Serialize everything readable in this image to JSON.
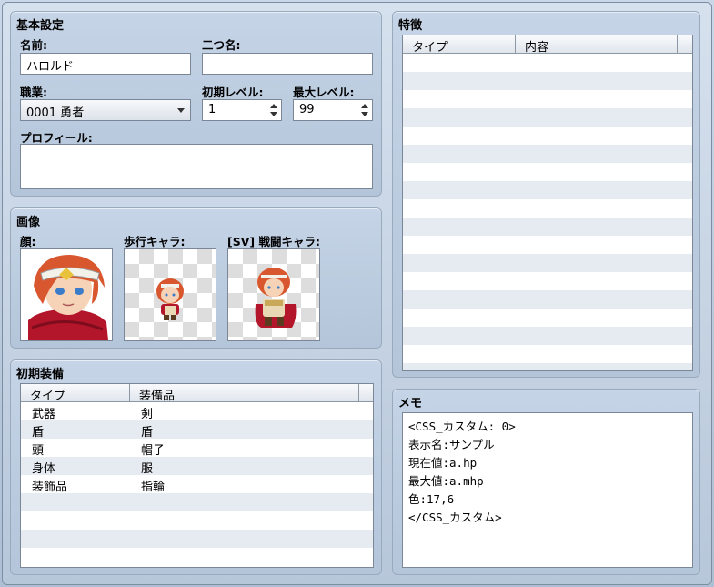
{
  "basic": {
    "title": "基本設定",
    "name_label": "名前:",
    "name_value": "ハロルド",
    "nickname_label": "二つ名:",
    "nickname_value": "",
    "class_label": "職業:",
    "class_value": "0001 勇者",
    "initial_level_label": "初期レベル:",
    "initial_level_value": "1",
    "max_level_label": "最大レベル:",
    "max_level_value": "99",
    "profile_label": "プロフィール:",
    "profile_value": ""
  },
  "images": {
    "title": "画像",
    "face_label": "顔:",
    "character_label": "歩行キャラ:",
    "battler_label": "[SV] 戦闘キャラ:"
  },
  "equipment": {
    "title": "初期装備",
    "columns": [
      "タイプ",
      "装備品"
    ],
    "rows": [
      [
        "武器",
        "剣"
      ],
      [
        "盾",
        "盾"
      ],
      [
        "頭",
        "帽子"
      ],
      [
        "身体",
        "服"
      ],
      [
        "装飾品",
        "指輪"
      ]
    ]
  },
  "traits": {
    "title": "特徴",
    "columns": [
      "タイプ",
      "内容"
    ]
  },
  "memo": {
    "title": "メモ",
    "lines": [
      "<CSS_カスタム: 0>",
      "表示名:サンプル",
      "現在値:a.hp",
      "最大値:a.mhp",
      "色:17,6",
      "</CSS_カスタム>"
    ]
  },
  "colors": {
    "panel": "#bccbdd",
    "hair": "#d9572f",
    "scarf": "#b3152a"
  }
}
